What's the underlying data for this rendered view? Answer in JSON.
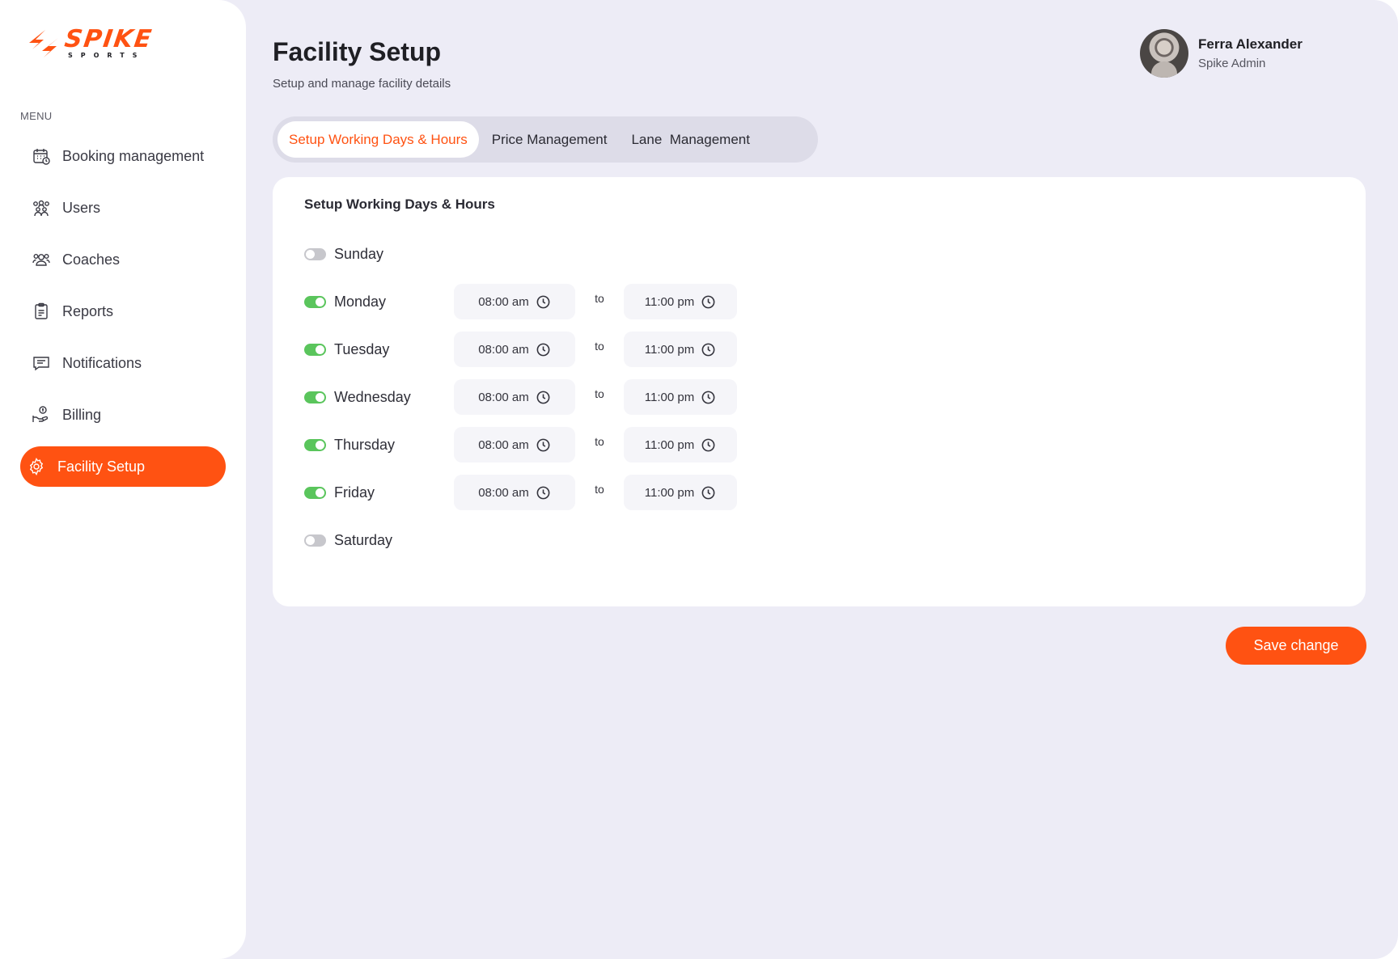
{
  "brand": {
    "name": "SPIKE",
    "tagline": "SPORTS",
    "accent": "#ff5212"
  },
  "sidebar": {
    "menu_label": "MENU",
    "items": [
      {
        "label": "Booking management",
        "icon": "calendar-icon"
      },
      {
        "label": "Users",
        "icon": "users-group-icon"
      },
      {
        "label": "Coaches",
        "icon": "coaches-icon"
      },
      {
        "label": "Reports",
        "icon": "clipboard-icon"
      },
      {
        "label": "Notifications",
        "icon": "message-icon"
      },
      {
        "label": "Billing",
        "icon": "hand-coin-icon"
      },
      {
        "label": "Facility Setup",
        "icon": "gear-icon",
        "active": true
      }
    ]
  },
  "header": {
    "title": "Facility Setup",
    "subtitle": "Setup and manage facility details"
  },
  "profile": {
    "name": "Ferra Alexander",
    "role": "Spike Admin"
  },
  "tabs": [
    {
      "label": "Setup Working Days & Hours",
      "active": true
    },
    {
      "label": "Price Management",
      "active": false
    },
    {
      "label": "Lane  Management",
      "active": false
    }
  ],
  "schedule": {
    "title": "Setup Working Days & Hours",
    "separator": "to",
    "days": [
      {
        "name": "Sunday",
        "enabled": false,
        "open": "",
        "close": ""
      },
      {
        "name": "Monday",
        "enabled": true,
        "open": "08:00 am",
        "close": "11:00 pm"
      },
      {
        "name": "Tuesday",
        "enabled": true,
        "open": "08:00 am",
        "close": "11:00 pm"
      },
      {
        "name": "Wednesday",
        "enabled": true,
        "open": "08:00 am",
        "close": "11:00 pm"
      },
      {
        "name": "Thursday",
        "enabled": true,
        "open": "08:00 am",
        "close": "11:00 pm"
      },
      {
        "name": "Friday",
        "enabled": true,
        "open": "08:00 am",
        "close": "11:00 pm"
      },
      {
        "name": "Saturday",
        "enabled": false,
        "open": "",
        "close": ""
      }
    ]
  },
  "actions": {
    "save_label": "Save change"
  },
  "colors": {
    "toggle_on": "#5ac55c",
    "toggle_off": "#c7c7cc",
    "background": "#edecf6"
  }
}
